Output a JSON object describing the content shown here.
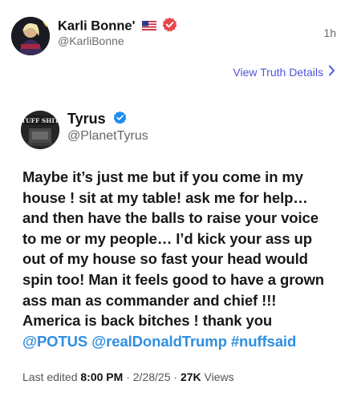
{
  "header": {
    "display_name": "Karli Bonne'",
    "flag_icon": "us-flag-icon",
    "handle": "@KarliBonne",
    "time": "1h"
  },
  "details_link": {
    "label": "View Truth Details",
    "icon": "chevron-right-icon"
  },
  "quoted": {
    "display_name": "Tyrus",
    "handle": "@PlanetTyrus",
    "avatar_text": "TUFF SHIT",
    "body_text": "Maybe it’s just me but if you come in my house ! sit at my table! ask me for help… and then have the balls to raise your voice to me or my people… I’d kick your ass up out of my house so fast your head would spin too! Man it feels good to have a grown ass man as commander and chief !!! America is back bitches ! thank you",
    "mentions": [
      "@POTUS",
      "@realDonaldTrump",
      "#nuffsaid"
    ]
  },
  "meta": {
    "edited_label": "Last edited",
    "time": "8:00 PM",
    "date": "2/28/25",
    "views_count": "27K",
    "views_label": "Views"
  },
  "colors": {
    "link": "#4e55d9",
    "mention": "#2f8fe0",
    "verified": "#e8474b",
    "verified_blue": "#1d8cf0"
  }
}
